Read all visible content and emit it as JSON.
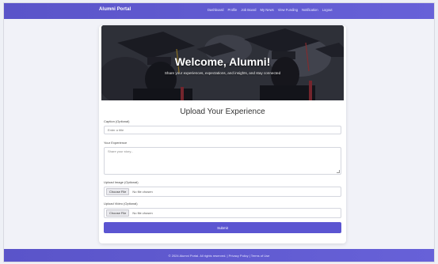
{
  "navbar": {
    "brand": "Alumni Portal",
    "links": [
      "Dashboard",
      "Profile",
      "Job Board",
      "My News",
      "View Funding",
      "Notification",
      "Logout"
    ]
  },
  "hero": {
    "title": "Welcome, Alumni!",
    "subtitle": "Share your experiences, expectations, and insights, and stay connected"
  },
  "form": {
    "title": "Upload Your Experience",
    "caption_label": "Caption (Optional)",
    "caption_placeholder": "Enter a title",
    "experience_label": "Your Experience",
    "experience_placeholder": "Share your story...",
    "image_label": "Upload Image (Optional)",
    "image_button": "Choose File",
    "image_status": "No file chosen",
    "video_label": "Upload Video (Optional)",
    "video_button": "Choose File",
    "video_status": "No file chosen",
    "submit_label": "Submit"
  },
  "footer": {
    "text": "© 2024 Alumni Portal. All rights reserved. | Privacy Policy | Terms of Use"
  },
  "colors": {
    "accent": "#5b55d1",
    "background": "#f1f2f8"
  }
}
